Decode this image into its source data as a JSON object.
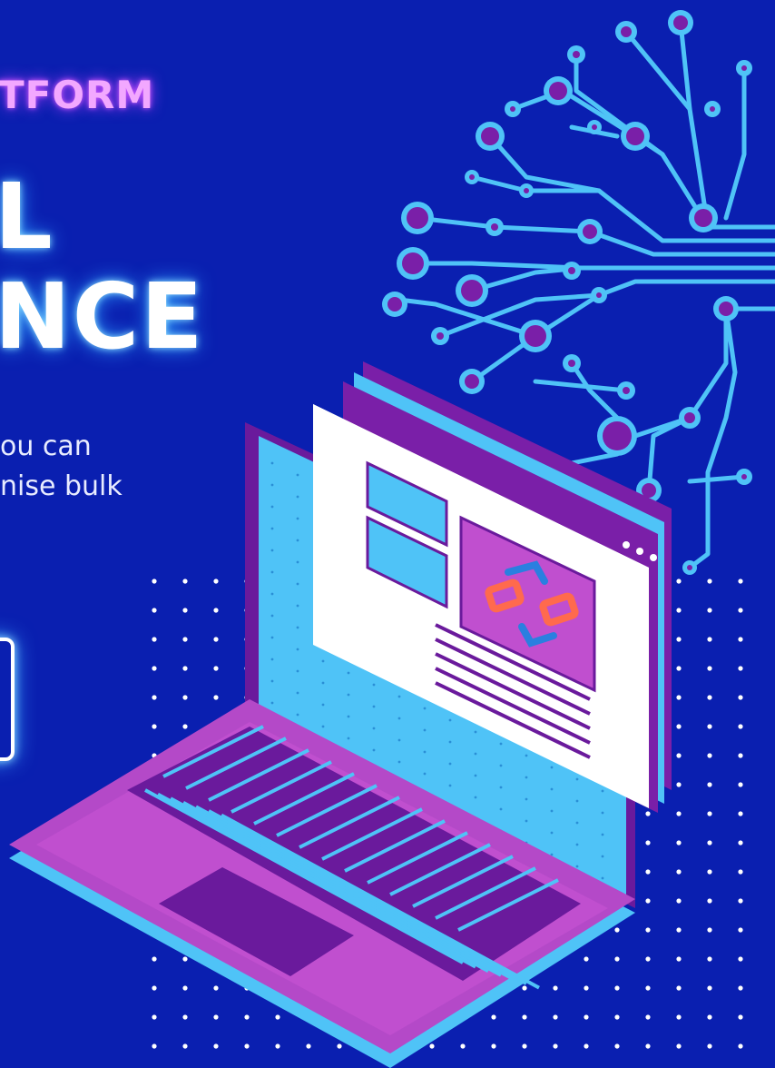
{
  "banner": {
    "tag": "TFORM",
    "headline_line1": "L",
    "headline_line2": "NCE",
    "body_line1": "ou can",
    "body_line2": "nise bulk"
  },
  "colors": {
    "background": "#0a1fb0",
    "neon_pink": "#c84bff",
    "neon_cyan": "#4fc3f7",
    "purple": "#6a1a9c",
    "magenta": "#b449c8"
  },
  "icons": [
    "circuit-brain-illustration",
    "laptop-illustration",
    "browser-window-illustration",
    "logo-icon"
  ]
}
